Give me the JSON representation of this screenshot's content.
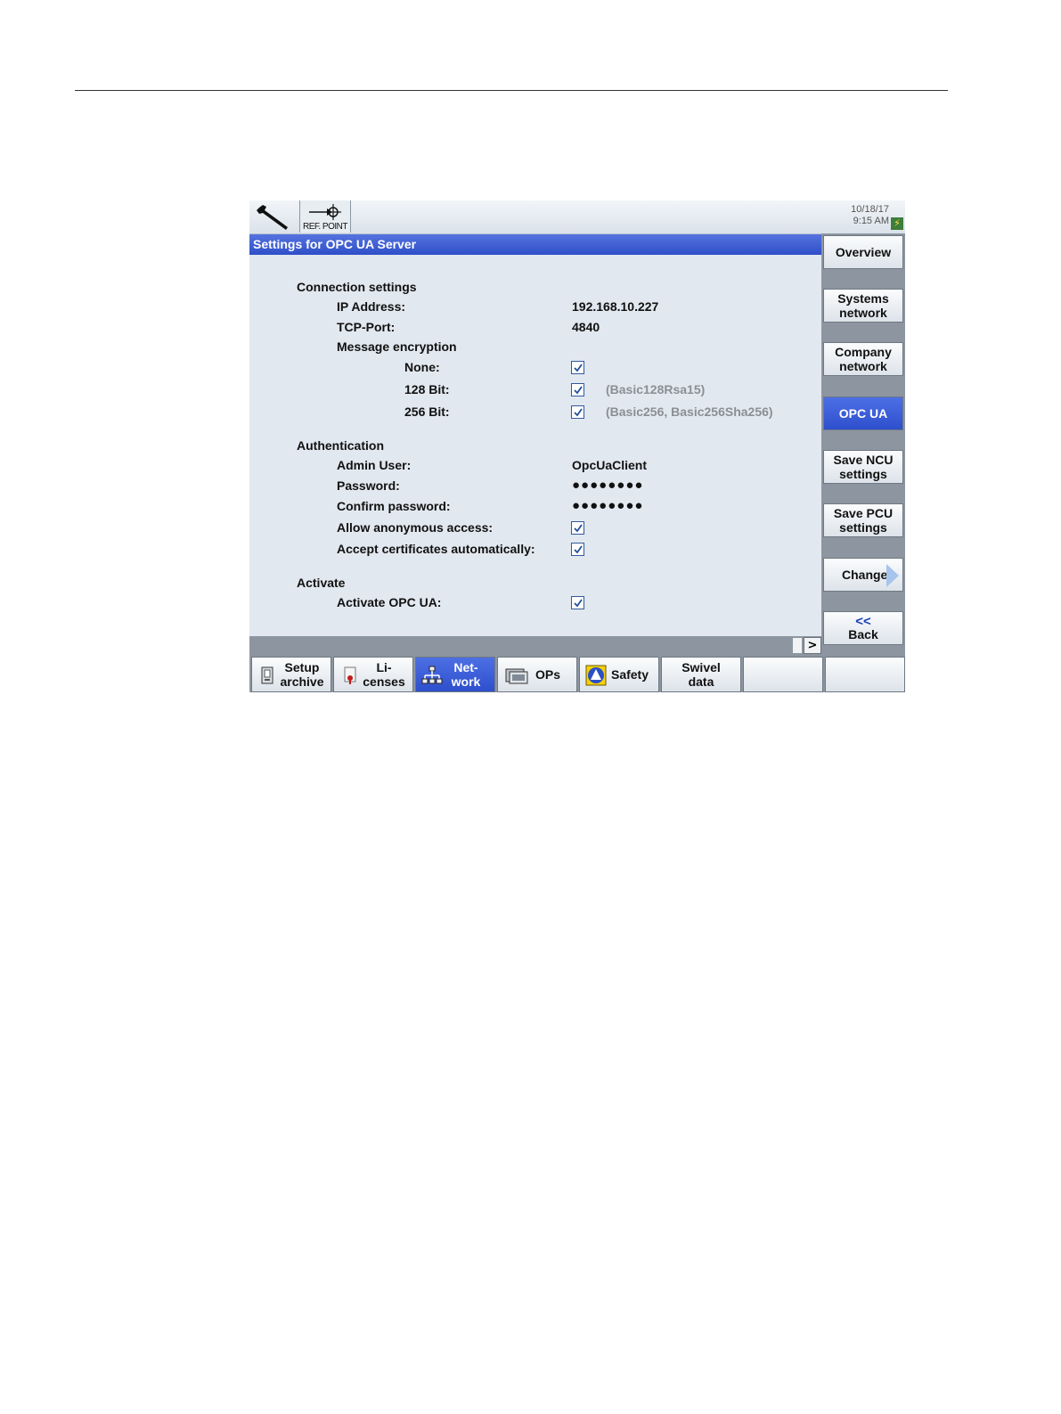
{
  "topbar": {
    "ref_label": "REF. POINT",
    "date": "10/18/17",
    "time": "9:15 AM"
  },
  "title": "Settings for OPC UA Server",
  "connection": {
    "heading": "Connection settings",
    "ip_label": "IP Address:",
    "ip_value": "192.168.10.227",
    "port_label": "TCP-Port:",
    "port_value": "4840",
    "encryption_heading": "Message encryption",
    "none_label": "None:",
    "bit128_label": "128 Bit:",
    "bit128_note": "(Basic128Rsa15)",
    "bit256_label": "256 Bit:",
    "bit256_note": "(Basic256, Basic256Sha256)"
  },
  "authentication": {
    "heading": "Authentication",
    "admin_label": "Admin User:",
    "admin_value": "OpcUaClient",
    "password_label": "Password:",
    "password_value": "●●●●●●●●",
    "confirm_label": "Confirm password:",
    "confirm_value": "●●●●●●●●",
    "anonymous_label": "Allow anonymous access:",
    "certificates_label": "Accept certificates automatically:"
  },
  "activate": {
    "heading": "Activate",
    "activate_label": "Activate OPC UA:"
  },
  "checkboxes": {
    "none": true,
    "bit128": true,
    "bit256": true,
    "anonymous": true,
    "certificates": true,
    "activate": true
  },
  "scroll_arrow": ">",
  "vertical_softkeys": {
    "overview": "Overview",
    "systems_1": "Systems",
    "systems_2": "network",
    "company_1": "Company",
    "company_2": "network",
    "opcua": "OPC UA",
    "ncu_1": "Save NCU",
    "ncu_2": "settings",
    "pcu_1": "Save PCU",
    "pcu_2": "settings",
    "change": "Change",
    "back_chevron": "<<",
    "back": "Back"
  },
  "horizontal_softkeys": {
    "setup_1": "Setup",
    "setup_2": "archive",
    "licenses_1": "Li-",
    "licenses_2": "censes",
    "network_1": "Net-",
    "network_2": "work",
    "ops": "OPs",
    "safety": "Safety",
    "swivel_1": "Swivel",
    "swivel_2": "data"
  },
  "colors": {
    "title_bar": "#2f4fc9",
    "active_softkey": "#3a5bd8",
    "background": "#e2e8ef"
  }
}
